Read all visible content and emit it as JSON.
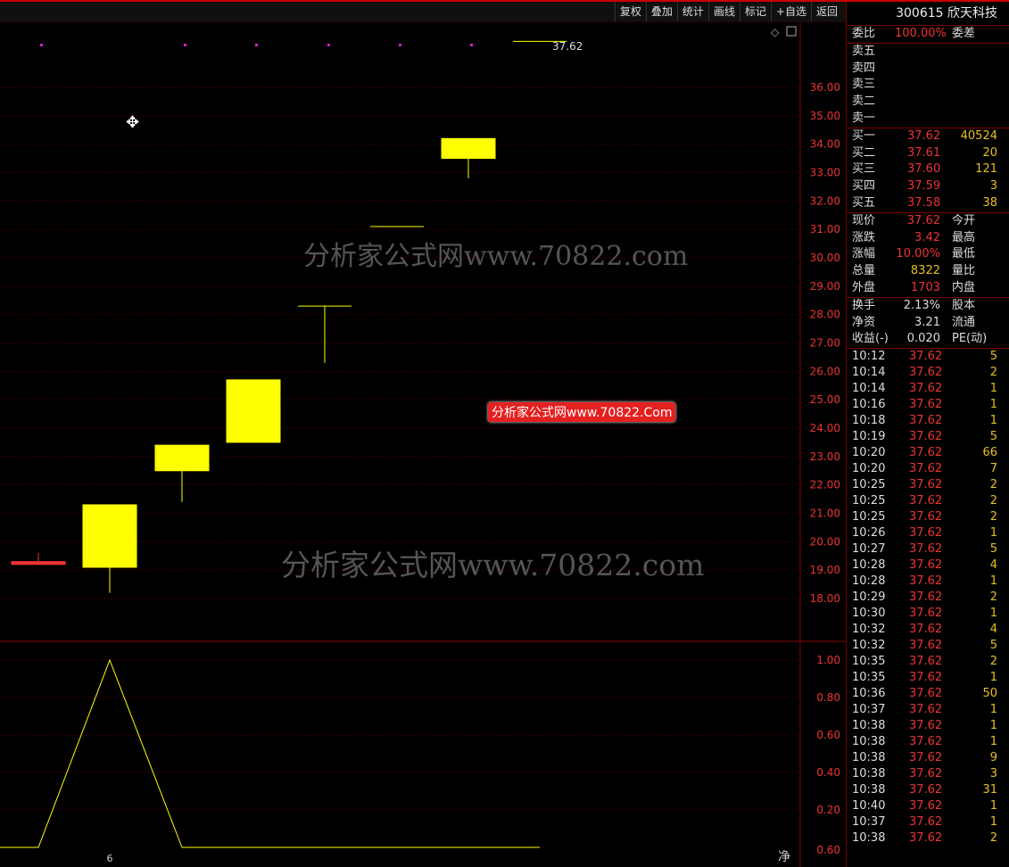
{
  "toolbar": {
    "buttons": [
      "复权",
      "叠加",
      "统计",
      "画线",
      "标记",
      "+自选",
      "返回"
    ]
  },
  "stock": {
    "code_name": "300615 欣天科技"
  },
  "order_book": {
    "ratio_label": "委比",
    "ratio_value": "100.00%",
    "diff_label": "委差",
    "sells": [
      "卖五",
      "卖四",
      "卖三",
      "卖二",
      "卖一"
    ],
    "buys": [
      {
        "label": "买一",
        "price": "37.62",
        "vol": "40524"
      },
      {
        "label": "买二",
        "price": "37.61",
        "vol": "20"
      },
      {
        "label": "买三",
        "price": "37.60",
        "vol": "121"
      },
      {
        "label": "买四",
        "price": "37.59",
        "vol": "3"
      },
      {
        "label": "买五",
        "price": "37.58",
        "vol": "38"
      }
    ]
  },
  "quote": [
    {
      "l": "现价",
      "v": "37.62",
      "l2": "今开"
    },
    {
      "l": "涨跌",
      "v": "3.42",
      "l2": "最高"
    },
    {
      "l": "涨幅",
      "v": "10.00%",
      "l2": "最低"
    },
    {
      "l": "总量",
      "v": "8322",
      "l2": "量比"
    },
    {
      "l": "外盘",
      "v": "1703",
      "l2": "内盘"
    }
  ],
  "fundamentals": [
    {
      "l": "换手",
      "v": "2.13%",
      "l2": "股本"
    },
    {
      "l": "净资",
      "v": "3.21",
      "l2": "流通"
    },
    {
      "l": "收益(-)",
      "v": "0.020",
      "l2": "PE(动)"
    }
  ],
  "ticks": [
    {
      "t": "10:12",
      "p": "37.62",
      "v": "5"
    },
    {
      "t": "10:14",
      "p": "37.62",
      "v": "2"
    },
    {
      "t": "10:14",
      "p": "37.62",
      "v": "1"
    },
    {
      "t": "10:16",
      "p": "37.62",
      "v": "1"
    },
    {
      "t": "10:18",
      "p": "37.62",
      "v": "1"
    },
    {
      "t": "10:19",
      "p": "37.62",
      "v": "5"
    },
    {
      "t": "10:20",
      "p": "37.62",
      "v": "66"
    },
    {
      "t": "10:20",
      "p": "37.62",
      "v": "7"
    },
    {
      "t": "10:25",
      "p": "37.62",
      "v": "2"
    },
    {
      "t": "10:25",
      "p": "37.62",
      "v": "2"
    },
    {
      "t": "10:25",
      "p": "37.62",
      "v": "2"
    },
    {
      "t": "10:26",
      "p": "37.62",
      "v": "1"
    },
    {
      "t": "10:27",
      "p": "37.62",
      "v": "5"
    },
    {
      "t": "10:28",
      "p": "37.62",
      "v": "4"
    },
    {
      "t": "10:28",
      "p": "37.62",
      "v": "1"
    },
    {
      "t": "10:29",
      "p": "37.62",
      "v": "2"
    },
    {
      "t": "10:30",
      "p": "37.62",
      "v": "1"
    },
    {
      "t": "10:32",
      "p": "37.62",
      "v": "4"
    },
    {
      "t": "10:32",
      "p": "37.62",
      "v": "5"
    },
    {
      "t": "10:35",
      "p": "37.62",
      "v": "2"
    },
    {
      "t": "10:35",
      "p": "37.62",
      "v": "1"
    },
    {
      "t": "10:36",
      "p": "37.62",
      "v": "50"
    },
    {
      "t": "10:37",
      "p": "37.62",
      "v": "1"
    },
    {
      "t": "10:38",
      "p": "37.62",
      "v": "1"
    },
    {
      "t": "10:38",
      "p": "37.62",
      "v": "1"
    },
    {
      "t": "10:38",
      "p": "37.62",
      "v": "9"
    },
    {
      "t": "10:38",
      "p": "37.62",
      "v": "3"
    },
    {
      "t": "10:38",
      "p": "37.62",
      "v": "31"
    },
    {
      "t": "10:40",
      "p": "37.62",
      "v": "1"
    },
    {
      "t": "10:37",
      "p": "37.62",
      "v": "1"
    },
    {
      "t": "10:38",
      "p": "37.62",
      "v": "2"
    }
  ],
  "watermark": {
    "text1": "分析家公式网www.70822.com",
    "text2": "分析家公式网www.70822.com",
    "text3": "分析家公式网www.70822.Com"
  },
  "bottom_labels": {
    "x_tick": "6",
    "corner": "净"
  },
  "chart_data": {
    "type": "candlestick",
    "last_price_label": "37.62",
    "price_axis_ticks": [
      "36.00",
      "35.00",
      "34.00",
      "33.00",
      "32.00",
      "31.00",
      "30.00",
      "29.00",
      "28.00",
      "27.00",
      "26.00",
      "25.00",
      "24.00",
      "23.00",
      "22.00",
      "21.00",
      "20.00",
      "19.00",
      "18.00"
    ],
    "candles": [
      {
        "open": 19.2,
        "close": 19.3,
        "high": 19.6,
        "low": 19.2,
        "color": "#e33"
      },
      {
        "open": 19.1,
        "close": 21.3,
        "high": 21.3,
        "low": 18.2,
        "color": "#ffff00"
      },
      {
        "open": 22.5,
        "close": 23.4,
        "high": 23.4,
        "low": 21.4,
        "color": "#ffff00"
      },
      {
        "open": 23.5,
        "close": 25.7,
        "high": 25.7,
        "low": 23.5,
        "color": "#ffff00"
      },
      {
        "open": 28.3,
        "close": 28.3,
        "high": 28.3,
        "low": 26.3,
        "color": "#ffff00"
      },
      {
        "open": 31.1,
        "close": 31.1,
        "high": 31.1,
        "low": 31.1,
        "color": "#ffff00"
      },
      {
        "open": 33.5,
        "close": 34.2,
        "high": 34.2,
        "low": 32.8,
        "color": "#ffff00"
      },
      {
        "open": 37.62,
        "close": 37.62,
        "high": 37.62,
        "low": 37.62,
        "color": "#ffff00"
      }
    ],
    "indicator_axis_ticks": [
      "1.00",
      "0.80",
      "0.60",
      "0.40",
      "0.20",
      "0.60"
    ],
    "indicator_values": [
      0,
      0,
      1,
      0,
      0,
      0,
      0,
      0,
      0,
      0,
      0,
      0,
      0,
      0,
      0
    ]
  },
  "colors": {
    "up": "#ffff00",
    "down_red": "#e33",
    "grid": "#5a0000",
    "accent_red": "#c00"
  }
}
